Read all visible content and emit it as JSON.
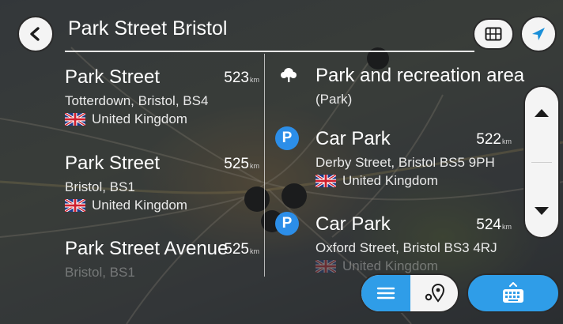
{
  "search": {
    "query": "Park Street Bristol"
  },
  "left_results": [
    {
      "name": "Park Street",
      "distance": "523",
      "unit": "km",
      "address": "Totterdown, Bristol, BS4",
      "country": "United Kingdom"
    },
    {
      "name": "Park Street",
      "distance": "525",
      "unit": "km",
      "address": "Bristol, BS1",
      "country": "United Kingdom"
    },
    {
      "name": "Park Street Avenue",
      "distance": "525",
      "unit": "km",
      "address": "Bristol, BS1"
    }
  ],
  "right_results": [
    {
      "name": "Park and recreation area",
      "category": "(Park)",
      "icon": "tree-icon"
    },
    {
      "name": "Car Park",
      "distance": "522",
      "unit": "km",
      "address": "Derby Street, Bristol BS5 9PH",
      "country": "United Kingdom",
      "icon_label": "P",
      "icon_color": "#2c8ee8"
    },
    {
      "name": "Car Park",
      "distance": "524",
      "unit": "km",
      "address": "Oxford Street, Bristol BS3 4RJ",
      "country": "United Kingdom",
      "icon_label": "P",
      "icon_color": "#2c8ee8"
    }
  ],
  "colors": {
    "accent": "#2f9de8",
    "button_bg": "#f4f4f4",
    "nav_arrow": "#1a8fd8"
  },
  "icons": {
    "back": "arrow-left-icon",
    "map": "map-icon",
    "navigate": "navigation-arrow-icon",
    "scroll_up": "chevron-up-icon",
    "scroll_down": "chevron-down-icon",
    "list_view": "list-icon",
    "map_pins": "map-pins-icon",
    "keyboard": "keyboard-icon"
  }
}
